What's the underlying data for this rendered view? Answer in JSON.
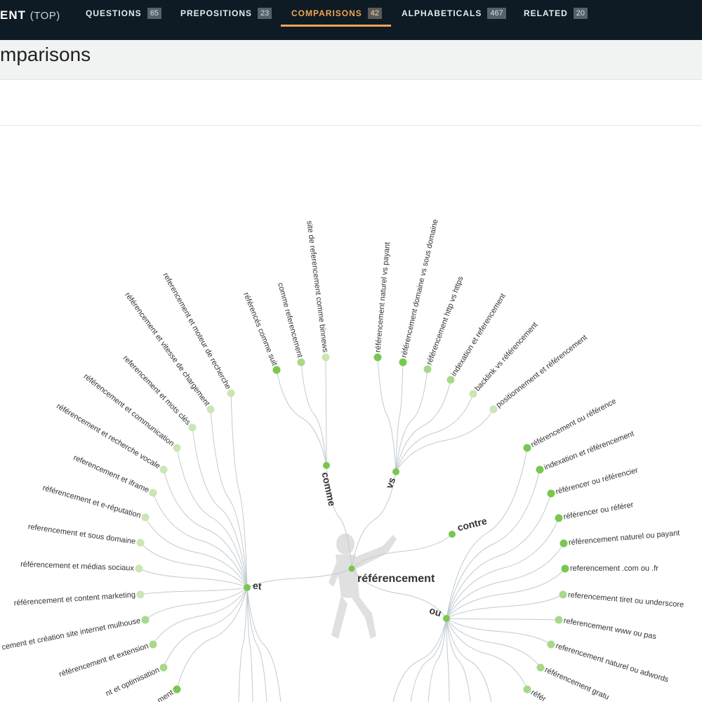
{
  "header": {
    "brand": "ENT",
    "brand_suffix": "(TOP)",
    "tabs": [
      {
        "label": "QUESTIONS",
        "count": "65"
      },
      {
        "label": "PREPOSITIONS",
        "count": "23"
      },
      {
        "label": "COMPARISONS",
        "count": "42",
        "active": true
      },
      {
        "label": "ALPHABETICALS",
        "count": "467"
      },
      {
        "label": "RELATED",
        "count": "20"
      }
    ]
  },
  "page": {
    "title": "mparisons"
  },
  "colors": {
    "accent": "#f0a553",
    "topbar": "#0e1b24",
    "node": "#7ac74f",
    "node_light": "#c9e6b4",
    "link": "#c2cad0"
  },
  "tree": {
    "root": "référencement",
    "hubs": [
      {
        "id": "comme",
        "label": "comme",
        "leaves": [
          {
            "label": "référencés comme suit",
            "shade": "dark"
          },
          {
            "label": "comme referencement",
            "shade": "mid"
          },
          {
            "label": "site de referencement comme binnews",
            "shade": "light"
          }
        ]
      },
      {
        "id": "vs",
        "label": "vs",
        "leaves": [
          {
            "label": "référencement naturel vs payant",
            "shade": "dark"
          },
          {
            "label": "référencement domaine vs sous domaine",
            "shade": "dark"
          },
          {
            "label": "référencement http vs https",
            "shade": "mid"
          },
          {
            "label": "indexation et referencement",
            "shade": "mid"
          },
          {
            "label": "backlink vs référencement",
            "shade": "light"
          },
          {
            "label": "positionnement et référencement",
            "shade": "light"
          }
        ]
      },
      {
        "id": "contre",
        "label": "contre",
        "leaves": []
      },
      {
        "id": "ou",
        "label": "ou",
        "leaves": [
          {
            "label": "référencement ou référence",
            "shade": "dark"
          },
          {
            "label": "indexation et référencement",
            "shade": "dark"
          },
          {
            "label": "référencer ou référencier",
            "shade": "dark"
          },
          {
            "label": "référencer ou référer",
            "shade": "dark"
          },
          {
            "label": "référencement naturel ou payant",
            "shade": "dark"
          },
          {
            "label": "referencement .com ou .fr",
            "shade": "dark"
          },
          {
            "label": "referencement tiret ou underscore",
            "shade": "mid"
          },
          {
            "label": "referencement www ou pas",
            "shade": "mid"
          },
          {
            "label": "referencement naturel ou adwords",
            "shade": "mid"
          },
          {
            "label": "référencement gratu",
            "shade": "mid"
          },
          {
            "label": "référ",
            "shade": "mid"
          }
        ]
      },
      {
        "id": "et",
        "label": "et",
        "leaves": [
          {
            "label": "referencement et moteur de recherche",
            "shade": "light"
          },
          {
            "label": "référencement et vitesse de chargement",
            "shade": "light"
          },
          {
            "label": "referencement et mots clés",
            "shade": "light"
          },
          {
            "label": "référencement et communication",
            "shade": "light"
          },
          {
            "label": "référencement et recherche vocale",
            "shade": "light"
          },
          {
            "label": "referencement et iframe",
            "shade": "light"
          },
          {
            "label": "référencement et e-réputation",
            "shade": "light"
          },
          {
            "label": "referencement et sous domaine",
            "shade": "light"
          },
          {
            "label": "référencement et médias sociaux",
            "shade": "light"
          },
          {
            "label": "référencement et content marketing",
            "shade": "light"
          },
          {
            "label": "cement et création site internet mulhouse",
            "shade": "mid"
          },
          {
            "label": "référencement et extension",
            "shade": "mid"
          },
          {
            "label": "nt et optimisation",
            "shade": "mid"
          },
          {
            "label": "ment",
            "shade": "dark"
          }
        ]
      }
    ]
  }
}
